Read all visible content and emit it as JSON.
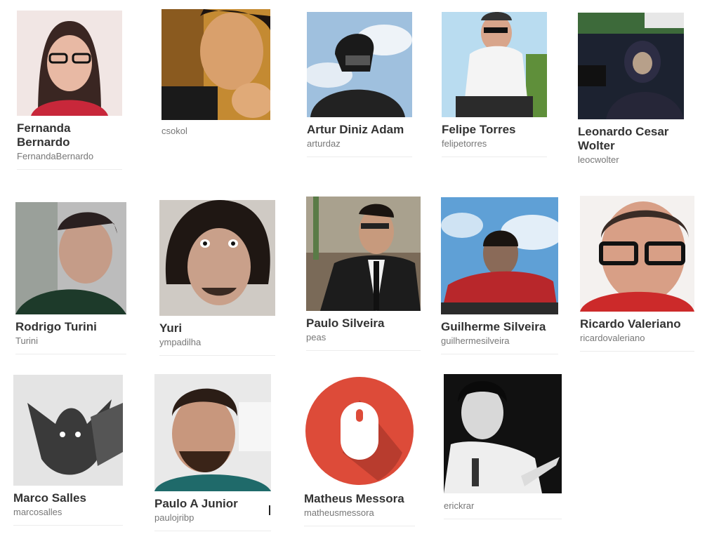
{
  "users": [
    {
      "name": "Fernanda Bernardo",
      "handle": "FernandaBernardo"
    },
    {
      "name": "",
      "handle": "csokol"
    },
    {
      "name": "Artur Diniz Adam",
      "handle": "arturdaz"
    },
    {
      "name": "Felipe Torres",
      "handle": "felipetorres"
    },
    {
      "name": "Leonardo Cesar Wolter",
      "handle": "leocwolter"
    },
    {
      "name": "Rodrigo Turini",
      "handle": "Turini"
    },
    {
      "name": "Yuri",
      "handle": "ympadilha"
    },
    {
      "name": "Paulo Silveira",
      "handle": "peas"
    },
    {
      "name": "Guilherme Silveira",
      "handle": "guilhermesilveira"
    },
    {
      "name": "Ricardo Valeriano",
      "handle": "ricardovaleriano"
    },
    {
      "name": "Marco Salles",
      "handle": "marcosalles"
    },
    {
      "name": "Paulo A Junior",
      "handle": "paulojribp"
    },
    {
      "name": "Matheus Messora",
      "handle": "matheusmessora"
    },
    {
      "name": "",
      "handle": "erickrar"
    }
  ],
  "colors": {
    "mouse_logo_red": "#dd4b39",
    "mouse_logo_shadow": "#b23a2d",
    "name_text": "#333333",
    "handle_text": "#777777"
  }
}
